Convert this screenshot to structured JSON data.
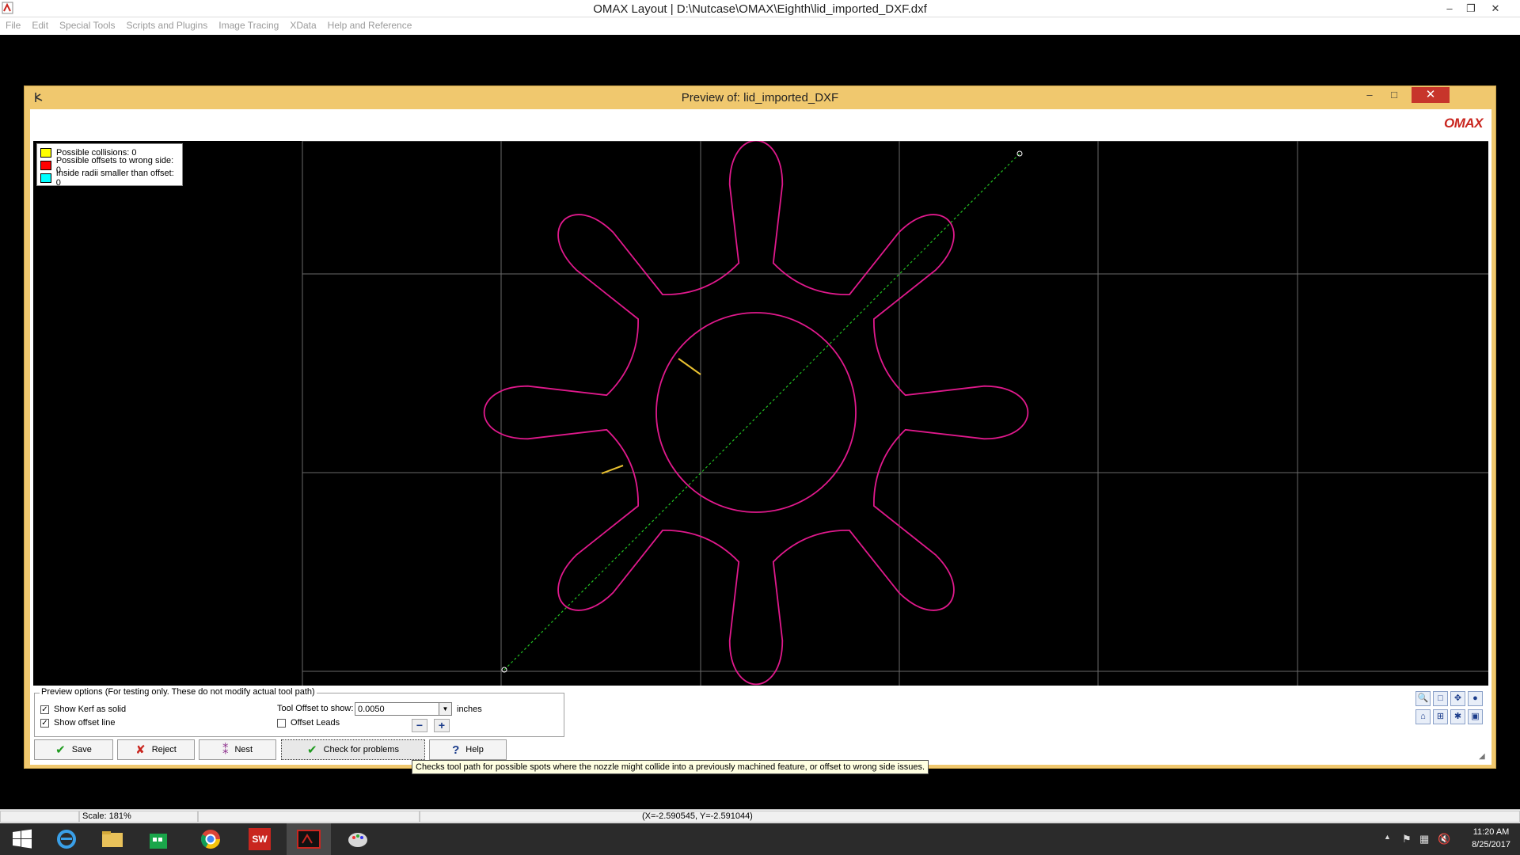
{
  "window": {
    "title": "OMAX Layout | D:\\Nutcase\\OMAX\\Eighth\\lid_imported_DXF.dxf",
    "minimize": "–",
    "restore": "❐",
    "close": "✕"
  },
  "menu": [
    "File",
    "Edit",
    "Special Tools",
    "Scripts and Plugins",
    "Image Tracing",
    "XData",
    "Help and Reference"
  ],
  "dialog": {
    "title": "Preview of: lid_imported_DXF",
    "logo": "OMAX",
    "minimize": "–",
    "maximize": "□",
    "close": "✕"
  },
  "legend": [
    {
      "label": "Possible collisions: 0",
      "color": "#ffff00"
    },
    {
      "label": "Possible offsets to wrong side: 0",
      "color": "#ff0000"
    },
    {
      "label": "Inside radii smaller than offset: 0",
      "color": "#00ffff"
    }
  ],
  "colors": {
    "part": "#e0198c",
    "offset_line": "#22c022",
    "grid": "#6a6a6a",
    "dialog_frame": "#f0c86e"
  },
  "options": {
    "group_label": "Preview options (For testing only. These do not modify actual tool path)",
    "show_kerf": {
      "label": "Show Kerf as solid",
      "checked": true
    },
    "show_offset": {
      "label": "Show offset line",
      "checked": true
    },
    "tool_offset_label": "Tool Offset to show:",
    "tool_offset_value": "0.0050",
    "units": "inches",
    "offset_leads": {
      "label": "Offset Leads",
      "checked": false
    },
    "minus": "−",
    "plus": "+"
  },
  "buttons": {
    "save": "Save",
    "reject": "Reject",
    "nest": "Nest",
    "check": "Check for problems",
    "help": "Help"
  },
  "tooltip": "Checks tool path for possible spots where the nozzle might collide into a previously machined feature, or offset to wrong side issues.",
  "status": {
    "scale": "Scale: 181%",
    "coords": "(X=-2.590545, Y=-2.591044)"
  },
  "clock": {
    "time": "11:20 AM",
    "date": "8/25/2017"
  }
}
